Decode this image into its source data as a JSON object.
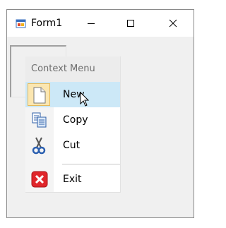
{
  "window": {
    "title": "Form1",
    "app_icon": "winforms-app-icon",
    "buttons": [
      "minimize-icon",
      "maximize-icon",
      "close-icon"
    ]
  },
  "context_menu": {
    "header": "Context Menu",
    "items": [
      {
        "label": "New",
        "icon": "new-document-icon",
        "state": "hover"
      },
      {
        "label": "Copy",
        "icon": "copy-icon",
        "state": "normal"
      },
      {
        "label": "Cut",
        "icon": "scissors-icon",
        "state": "normal"
      },
      {
        "label": "Exit",
        "icon": "exit-icon",
        "state": "normal"
      }
    ]
  },
  "colors": {
    "hover_background": "#cce8f7",
    "icon_highlight": "#fbe6b0",
    "exit_red": "#e0262b"
  }
}
